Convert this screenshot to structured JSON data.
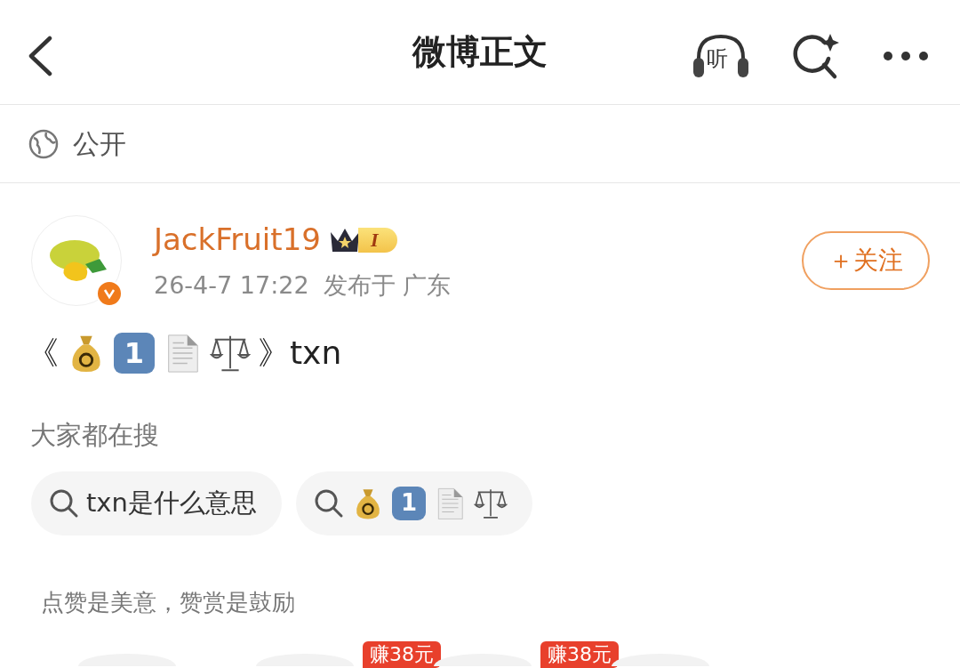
{
  "header": {
    "title": "微博正文",
    "listen_label": "听"
  },
  "visibility": {
    "label": "公开"
  },
  "author": {
    "name": "JackFruit19",
    "verified": true,
    "level_label": "I",
    "time": "26-4-7 17:22",
    "location": "发布于 广东",
    "follow_label": "＋关注"
  },
  "post": {
    "segments": [
      {
        "kind": "text",
        "text": "《"
      },
      {
        "kind": "money-bag"
      },
      {
        "kind": "keycap",
        "text": "1"
      },
      {
        "kind": "document"
      },
      {
        "kind": "scales"
      },
      {
        "kind": "text",
        "text": "》txn"
      }
    ]
  },
  "search_section": {
    "title": "大家都在搜",
    "chips": [
      {
        "segments": [
          {
            "kind": "text",
            "text": "txn是什么意思"
          }
        ]
      },
      {
        "segments": [
          {
            "kind": "money-bag"
          },
          {
            "kind": "keycap",
            "text": "1"
          },
          {
            "kind": "document"
          },
          {
            "kind": "scales"
          }
        ]
      }
    ]
  },
  "reward": {
    "title": "点赞是美意，赞赏是鼓励",
    "items": [
      {
        "kind": "plain"
      },
      {
        "kind": "promo",
        "badge": "赚38元"
      },
      {
        "kind": "promo",
        "badge": "赚38元"
      },
      {
        "kind": "plain"
      }
    ]
  }
}
